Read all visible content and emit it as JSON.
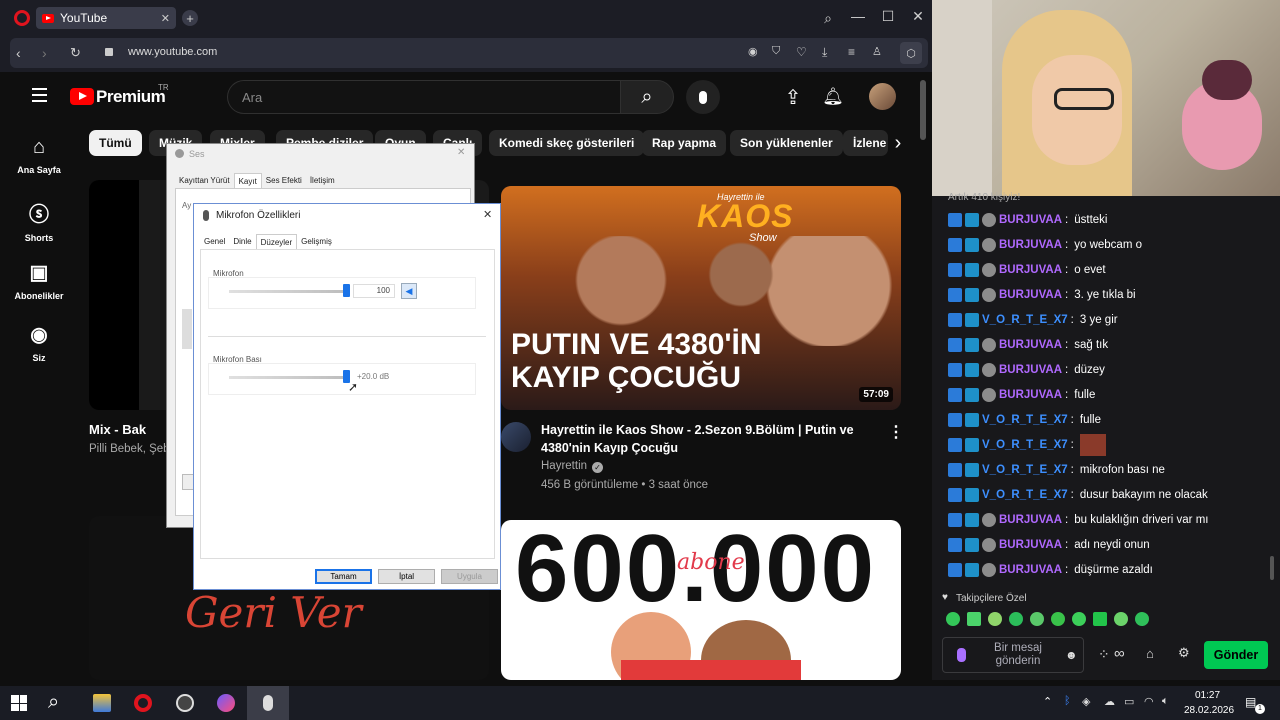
{
  "browser": {
    "tab_title": "YouTube",
    "url": "www.youtube.com"
  },
  "youtube": {
    "logo": "Premium",
    "logo_region": "TR",
    "search_placeholder": "Ara",
    "chips": [
      "Tümü",
      "Müzik",
      "Mixler",
      "Pembe diziler",
      "Oyun",
      "Canlı",
      "Komedi skeç gösterileri",
      "Rap yapma",
      "Son yüklenenler",
      "İzlene"
    ],
    "sidebar": [
      "Ana Sayfa",
      "Shorts",
      "Abonelikler",
      "Siz"
    ],
    "left_video": {
      "title": "Mix - Bak",
      "meta": "Pilli Bebek, Şeb"
    },
    "left_thumb2_text": "Geri Ver",
    "video1": {
      "thumb_title": "PUTIN VE 4380'İN KAYIP ÇOCUĞU",
      "thumb_logo": "KAOS",
      "thumb_logo_sub": "Hayrettin ile",
      "thumb_logo_show": "Show",
      "duration": "57:09",
      "title": "Hayrettin ile Kaos Show - 2.Sezon 9.Bölüm | Putin ve 4380'nin Kayıp Çocuğu",
      "channel": "Hayrettin",
      "stats": "456 B görüntüleme • 3 saat önce"
    },
    "video2": {
      "thumb_text": "600.000",
      "thumb_script": "abone"
    }
  },
  "sound_dialog": {
    "title": "Ses",
    "tabs": [
      "Kayıttan Yürüt",
      "Kayıt",
      "Ses Efekti",
      "İletişim"
    ],
    "peek": "Ay"
  },
  "mic_dialog": {
    "title": "Mikrofon Özellikleri",
    "tabs": [
      "Genel",
      "Dinle",
      "Düzeyler",
      "Gelişmiş"
    ],
    "mic_label": "Mikrofon",
    "mic_value": "100",
    "mic_level": 1.0,
    "boost_label": "Mikrofon Bası",
    "boost_value": "+20.0 dB",
    "boost_level": 1.0,
    "ok": "Tamam",
    "cancel": "İptal",
    "apply": "Uygula"
  },
  "chat": {
    "top_partial": "Artık 410 kişiyiz!",
    "messages": [
      {
        "user": "BURJUVAA",
        "text": "üstteki",
        "color": "#b069ff"
      },
      {
        "user": "BURJUVAA",
        "text": "yo webcam o",
        "color": "#b069ff"
      },
      {
        "user": "BURJUVAA",
        "text": "o evet",
        "color": "#b069ff"
      },
      {
        "user": "BURJUVAA",
        "text": "3. ye tıkla bi",
        "color": "#b069ff"
      },
      {
        "user": "V_O_R_T_E_X7",
        "text": "3 ye gir",
        "color": "#3d8fff"
      },
      {
        "user": "BURJUVAA",
        "text": "sağ tık",
        "color": "#b069ff"
      },
      {
        "user": "BURJUVAA",
        "text": "düzey",
        "color": "#b069ff"
      },
      {
        "user": "BURJUVAA",
        "text": "fulle",
        "color": "#b069ff"
      },
      {
        "user": "V_O_R_T_E_X7",
        "text": "fulle",
        "color": "#3d8fff"
      },
      {
        "user": "V_O_R_T_E_X7",
        "text": "",
        "color": "#3d8fff"
      },
      {
        "user": "V_O_R_T_E_X7",
        "text": "mikrofon bası ne",
        "color": "#3d8fff"
      },
      {
        "user": "V_O_R_T_E_X7",
        "text": "dusur bakayım ne olacak",
        "color": "#3d8fff"
      },
      {
        "user": "BURJUVAA",
        "text": "bu kulaklığın driveri var mı",
        "color": "#b069ff"
      },
      {
        "user": "BURJUVAA",
        "text": "adı neydi onun",
        "color": "#b069ff"
      },
      {
        "user": "BURJUVAA",
        "text": "düşürme azaldı",
        "color": "#b069ff"
      }
    ],
    "followers_label": "Takipçilere Özel",
    "input_placeholder": "Bir mesaj gönderin",
    "send": "Gönder"
  },
  "taskbar": {
    "time": "01:27",
    "date": "28.02.2026",
    "notif": "1"
  }
}
